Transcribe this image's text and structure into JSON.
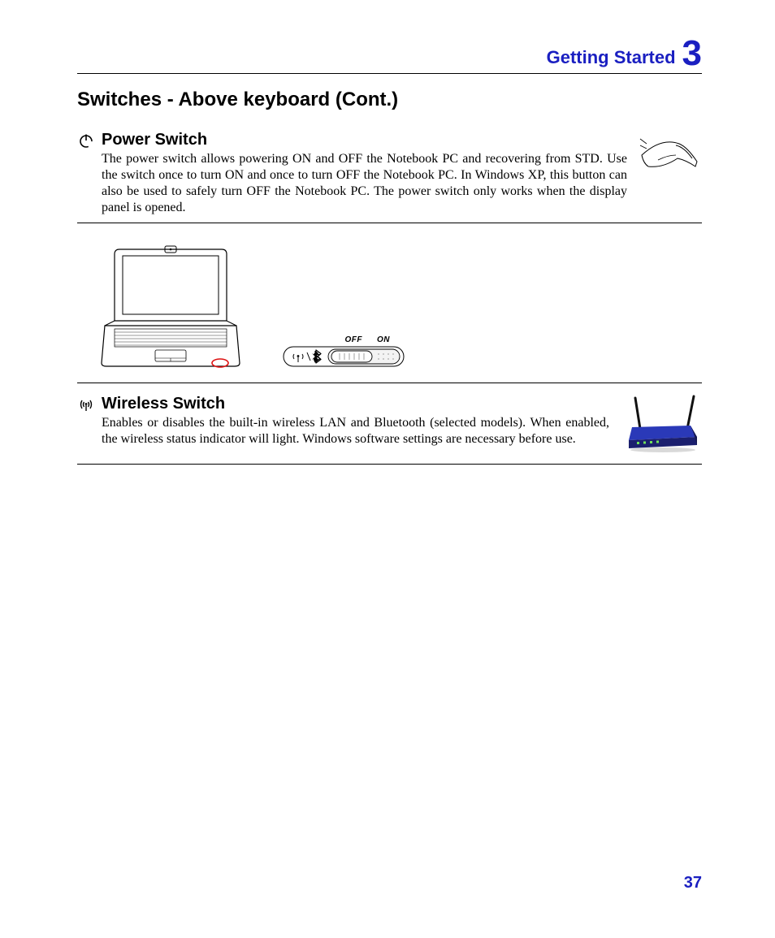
{
  "header": {
    "title": "Getting Started",
    "chapter": "3"
  },
  "section_title": "Switches - Above keyboard (Cont.)",
  "power": {
    "heading": "Power Switch",
    "body": "The power switch allows powering ON and OFF the Notebook PC and recovering from STD. Use the switch once to turn ON and once to turn OFF the Notebook PC. In Windows XP, this button can also be used to safely turn OFF the Notebook PC. The power switch only works when the display panel is opened."
  },
  "switch_label_off": "OFF",
  "switch_label_on": "ON",
  "wireless": {
    "heading": "Wireless Switch",
    "body": "Enables or disables the built-in wireless LAN and Bluetooth (selected models). When enabled, the wireless status indicator will light. Windows software settings are necessary before use."
  },
  "page_number": "37"
}
